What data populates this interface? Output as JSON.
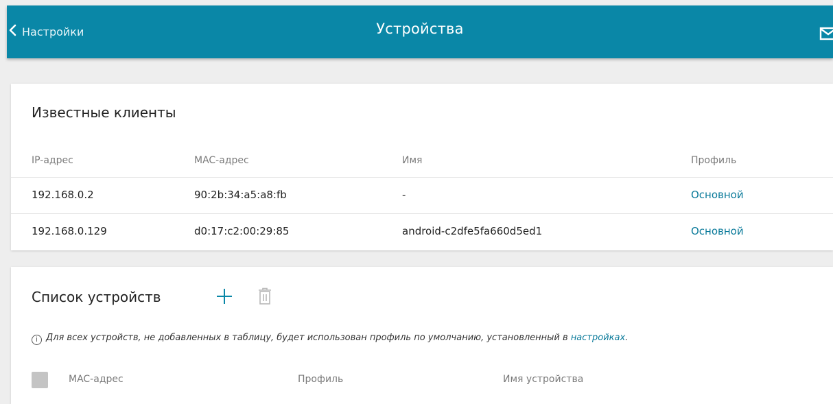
{
  "header": {
    "back_label": "Настройки",
    "title": "Устройства",
    "background": "#0a87a7",
    "icons": {
      "back": "chevron-left-icon",
      "mail": "mail-icon"
    }
  },
  "known_clients": {
    "title": "Известные клиенты",
    "columns": [
      "IP-адрес",
      "MAC-адрес",
      "Имя",
      "Профиль"
    ],
    "rows": [
      {
        "ip": "192.168.0.2",
        "mac": "90:2b:34:a5:a8:fb",
        "name": "-",
        "profile": "Основной"
      },
      {
        "ip": "192.168.0.129",
        "mac": "d0:17:c2:00:29:85",
        "name": "android-c2dfe5fa660d5ed1",
        "profile": "Основной"
      }
    ]
  },
  "device_list": {
    "title": "Список устройств",
    "icons": {
      "add": "plus-icon",
      "delete": "trash-icon",
      "info": "info-icon"
    },
    "info_text": "Для всех устройств, не добавленных в таблицу, будет использован профиль по умолчанию, установленный в ",
    "info_link": "настройках",
    "info_end": ".",
    "columns": [
      "MAC-адрес",
      "Профиль",
      "Имя устройства"
    ]
  },
  "colors": {
    "accent": "#0a87a7",
    "link": "#0a7a9a",
    "muted": "#7a7a7a",
    "page_bg": "#eeeeee"
  }
}
